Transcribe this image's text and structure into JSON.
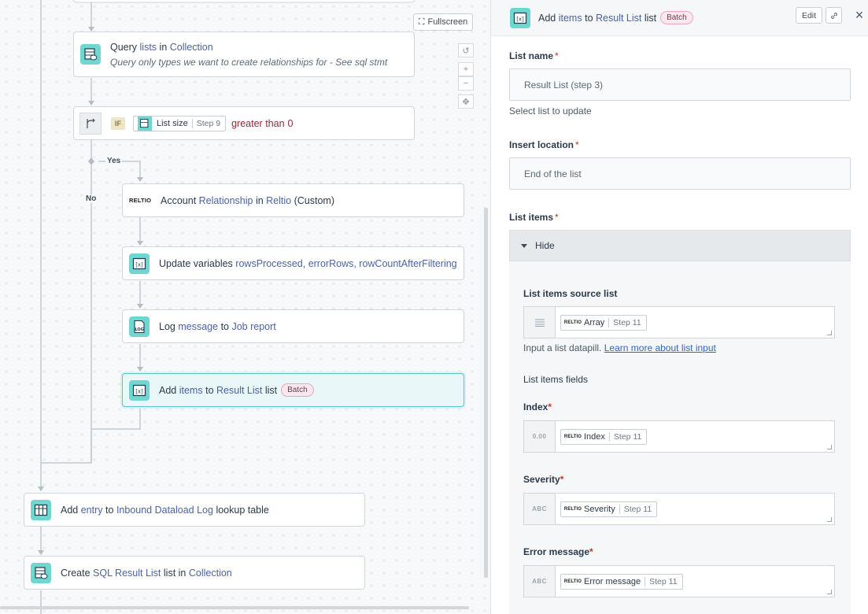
{
  "canvas": {
    "fullscreen_label": "Fullscreen",
    "steps": {
      "query": {
        "verb": "Query",
        "obj": "lists",
        "prep": "in",
        "app": "Collection",
        "comment": "Query only types we want to create relationships for - See sql stmt"
      },
      "if": {
        "tag": "IF",
        "pill_label": "List size",
        "pill_step": "Step 9",
        "op": "greater than",
        "value": "0"
      },
      "reltio": {
        "logo": "RELTIO",
        "pre": "Account",
        "obj": "Relationship",
        "prep": "in",
        "app": "Reltio",
        "suffix": "(Custom)"
      },
      "update": {
        "pre": "Update variables",
        "vars": "rowsProcessed, errorRows, rowCountAfterFiltering"
      },
      "log": {
        "pre": "Log",
        "obj": "message",
        "prep": "to",
        "target": "Job report"
      },
      "add_items": {
        "pre": "Add",
        "obj": "items",
        "prep": "to",
        "target": "Result List",
        "suffix": "list",
        "badge": "Batch"
      },
      "add_entry": {
        "pre": "Add",
        "obj": "entry",
        "prep": "to",
        "target": "Inbound Dataload Log",
        "suffix": "lookup table"
      },
      "create_sql": {
        "pre": "Create",
        "target": "SQL Result List",
        "mid": "list in",
        "app": "Collection"
      }
    },
    "branch_yes": "Yes",
    "branch_no": "No"
  },
  "panel": {
    "title": {
      "pre": "Add",
      "obj": "items",
      "prep": "to",
      "target": "Result List",
      "suffix": "list",
      "badge": "Batch"
    },
    "edit_label": "Edit",
    "list_name": {
      "label": "List name",
      "value": "Result List (step 3)",
      "help": "Select list to update"
    },
    "insert_location": {
      "label": "Insert location",
      "value": "End of the list"
    },
    "list_items": {
      "label": "List items",
      "toggle": "Hide",
      "source": {
        "label": "List items source list",
        "pill_label": "Array",
        "pill_step": "Step 11",
        "help": "Input a list datapill.",
        "help_link": "Learn more about list input"
      },
      "fields_label": "List items fields",
      "index": {
        "label": "Index",
        "type": "0.00",
        "pill_label": "Index",
        "pill_step": "Step 11"
      },
      "severity": {
        "label": "Severity",
        "type": "ABC",
        "pill_label": "Severity",
        "pill_step": "Step 11"
      },
      "error": {
        "label": "Error message",
        "type": "ABC",
        "pill_label": "Error message",
        "pill_step": "Step 11"
      }
    },
    "pill_logo": "RELTIO"
  }
}
